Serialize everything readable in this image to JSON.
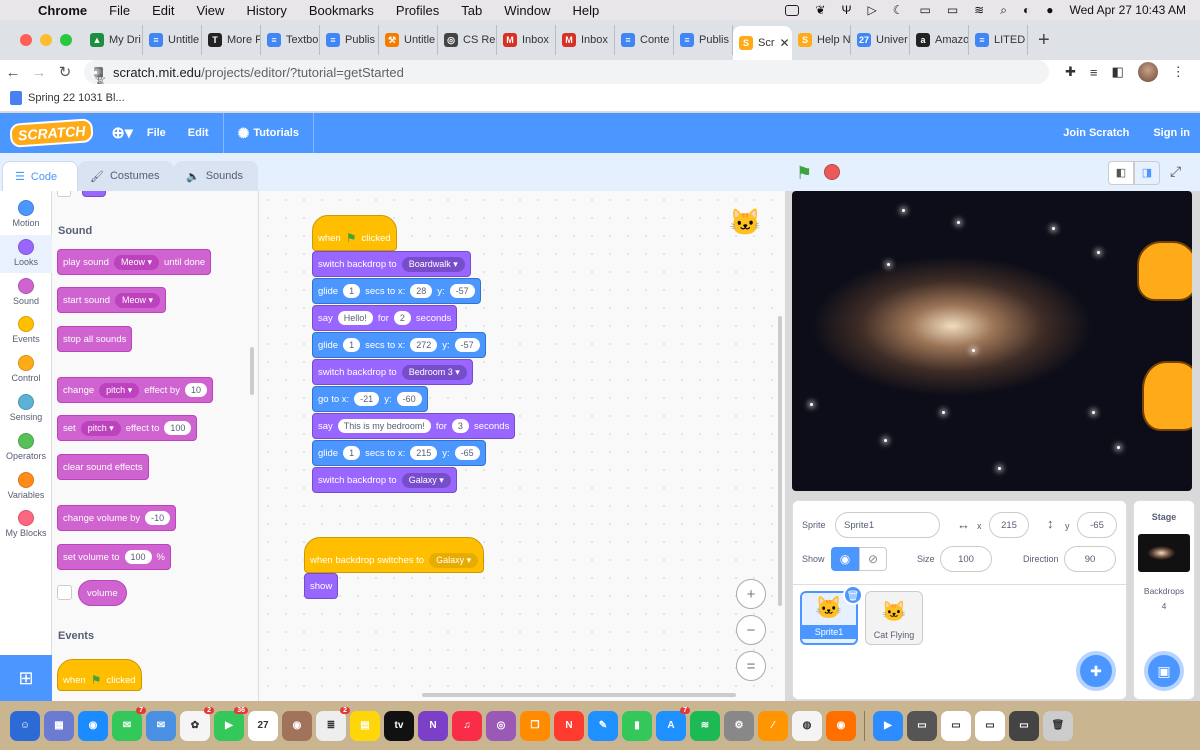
{
  "menubar": {
    "app": "Chrome",
    "items": [
      "File",
      "Edit",
      "View",
      "History",
      "Bookmarks",
      "Profiles",
      "Tab",
      "Window",
      "Help"
    ],
    "clock": "Wed Apr 27  10:43 AM"
  },
  "tabs": [
    {
      "label": "My Dri",
      "color": "#1e8e3e",
      "glyph": "▲"
    },
    {
      "label": "Untitle",
      "color": "#4285f4",
      "glyph": "≡"
    },
    {
      "label": "More F",
      "color": "#222",
      "glyph": "T"
    },
    {
      "label": "Textbo",
      "color": "#4285f4",
      "glyph": "≡"
    },
    {
      "label": "Publis",
      "color": "#4285f4",
      "glyph": "≡"
    },
    {
      "label": "Untitle",
      "color": "#f57c00",
      "glyph": "⚒"
    },
    {
      "label": "CS Re",
      "color": "#444",
      "glyph": "◎"
    },
    {
      "label": "Inbox",
      "color": "#d93025",
      "glyph": "M"
    },
    {
      "label": "Inbox",
      "color": "#d93025",
      "glyph": "M"
    },
    {
      "label": "Conte",
      "color": "#4285f4",
      "glyph": "≡"
    },
    {
      "label": "Publis",
      "color": "#4285f4",
      "glyph": "≡"
    },
    {
      "label": "Scr",
      "color": "#ffab19",
      "glyph": "S",
      "active": true
    },
    {
      "label": "Help N",
      "color": "#ffab19",
      "glyph": "S"
    },
    {
      "label": "Univer",
      "color": "#4285f4",
      "glyph": "27"
    },
    {
      "label": "Amazo",
      "color": "#222",
      "glyph": "a"
    },
    {
      "label": "LITED",
      "color": "#4285f4",
      "glyph": "≡"
    }
  ],
  "address": {
    "domain": "scratch.mit.edu",
    "path": "/projects/editor/?tutorial=getStarted"
  },
  "bookmark": "Spring 22 1031 Bl...",
  "scratch": {
    "logo": "SCRATCH",
    "file": "File",
    "edit": "Edit",
    "tutorials": "Tutorials",
    "join": "Join Scratch",
    "signin": "Sign in"
  },
  "editor_tabs": {
    "code": "Code",
    "costumes": "Costumes",
    "sounds": "Sounds"
  },
  "categories": [
    {
      "label": "Motion",
      "color": "#4c97ff"
    },
    {
      "label": "Looks",
      "color": "#9966ff"
    },
    {
      "label": "Sound",
      "color": "#cf63cf"
    },
    {
      "label": "Events",
      "color": "#ffbf00"
    },
    {
      "label": "Control",
      "color": "#ffab19"
    },
    {
      "label": "Sensing",
      "color": "#5cb1d6"
    },
    {
      "label": "Operators",
      "color": "#59c059"
    },
    {
      "label": "Variables",
      "color": "#ff8c1a"
    },
    {
      "label": "My Blocks",
      "color": "#ff6680"
    }
  ],
  "palette": {
    "sound_header": "Sound",
    "play_sound": "play sound",
    "meow": "Meow",
    "until_done": "until done",
    "start_sound": "start sound",
    "stop_all": "stop all sounds",
    "change": "change",
    "pitch": "pitch",
    "effect_by": "effect by",
    "ten": "10",
    "set": "set",
    "effect_to": "effect to",
    "hundred": "100",
    "clear_effects": "clear sound effects",
    "change_volume": "change volume by",
    "minus_ten": "-10",
    "set_volume": "set volume to",
    "percent": "%",
    "volume": "volume",
    "events_header": "Events",
    "when": "when",
    "clicked": "clicked"
  },
  "script1": {
    "when": "when",
    "clicked": "clicked",
    "b1": "switch backdrop to",
    "b1v": "Boardwalk",
    "glide": "glide",
    "secs_to_x": "secs to x:",
    "y": "y:",
    "g1s": "1",
    "g1x": "28",
    "g1y": "-57",
    "say": "say",
    "hello": "Hello!",
    "for": "for",
    "two": "2",
    "seconds": "seconds",
    "g2s": "1",
    "g2x": "272",
    "g2y": "-57",
    "b2v": "Bedroom 3",
    "goto": "go to x:",
    "gx": "-21",
    "gy": "-60",
    "bedroom": "This is my bedroom!",
    "three": "3",
    "g3s": "1",
    "g3x": "215",
    "g3y": "-65",
    "b3v": "Galaxy"
  },
  "script2": {
    "hat": "when backdrop switches to",
    "value": "Galaxy",
    "show": "show"
  },
  "zoom": {
    "in": "+",
    "out": "−",
    "reset": "="
  },
  "sprite_info": {
    "sprite_label": "Sprite",
    "sprite_name": "Sprite1",
    "x_label": "x",
    "x": "215",
    "y_label": "y",
    "y": "-65",
    "show_label": "Show",
    "size_label": "Size",
    "size": "100",
    "dir_label": "Direction",
    "dir": "90"
  },
  "sprites": [
    {
      "name": "Sprite1",
      "selected": true
    },
    {
      "name": "Cat Flying",
      "selected": false
    }
  ],
  "stage_panel": {
    "title": "Stage",
    "backdrops_label": "Backdrops",
    "backdrops": "4"
  },
  "dock": [
    {
      "c": "#2c6bd6",
      "g": "☺"
    },
    {
      "c": "#6b7bd1",
      "g": "▦"
    },
    {
      "c": "#1a8cff",
      "g": "◉"
    },
    {
      "c": "#34c759",
      "g": "✉",
      "b": "7"
    },
    {
      "c": "#4a90e2",
      "g": "✉"
    },
    {
      "c": "#f5f5f5",
      "g": "✿",
      "b": "2"
    },
    {
      "c": "#34c759",
      "g": "▶",
      "b": "36"
    },
    {
      "c": "#ffffff",
      "g": "27"
    },
    {
      "c": "#a0735a",
      "g": "◉"
    },
    {
      "c": "#eeeeee",
      "g": "≣",
      "b": "2"
    },
    {
      "c": "#ffd60a",
      "g": "▤"
    },
    {
      "c": "#111",
      "g": "tv"
    },
    {
      "c": "#7b3fc8",
      "g": "N"
    },
    {
      "c": "#fa2d48",
      "g": "♫"
    },
    {
      "c": "#9b59b6",
      "g": "◎"
    },
    {
      "c": "#ff8c00",
      "g": "❒"
    },
    {
      "c": "#ff3b30",
      "g": "N"
    },
    {
      "c": "#1e90ff",
      "g": "✎"
    },
    {
      "c": "#34c759",
      "g": "▮"
    },
    {
      "c": "#1e90ff",
      "g": "A",
      "b": "7"
    },
    {
      "c": "#1db954",
      "g": "≋"
    },
    {
      "c": "#888",
      "g": "⚙"
    },
    {
      "c": "#ff9500",
      "g": "⁄"
    },
    {
      "c": "#f4f4f4",
      "g": "◍"
    },
    {
      "c": "#ff6f00",
      "g": "◉"
    },
    {
      "c": "#2d8cff",
      "g": "▶"
    },
    {
      "c": "#555",
      "g": "▭"
    },
    {
      "c": "#fff",
      "g": "▭"
    },
    {
      "c": "#fff",
      "g": "▭"
    },
    {
      "c": "#444",
      "g": "▭"
    },
    {
      "c": "#ccc",
      "g": "🗑"
    }
  ]
}
